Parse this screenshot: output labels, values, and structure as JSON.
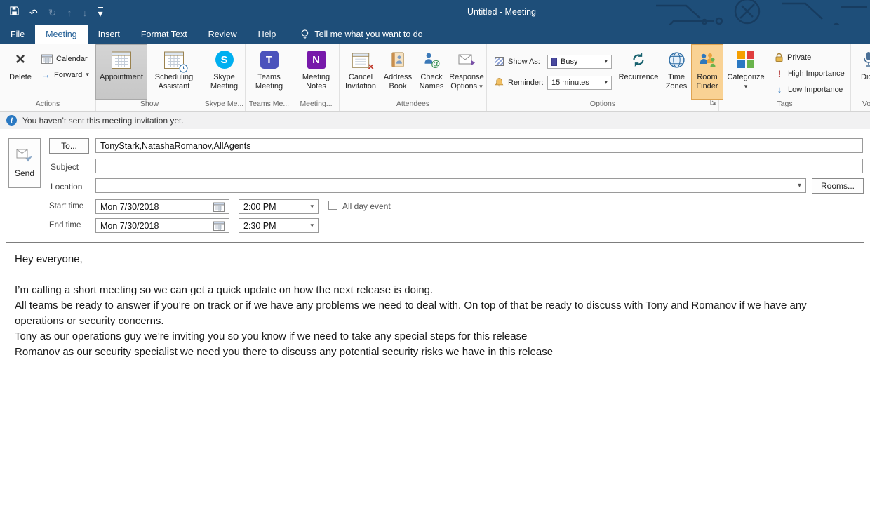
{
  "titlebar": {
    "title": "Untitled  -  Meeting"
  },
  "tabs": {
    "file": "File",
    "meeting": "Meeting",
    "insert": "Insert",
    "format_text": "Format Text",
    "review": "Review",
    "help": "Help",
    "tell_me": "Tell me what you want to do"
  },
  "ribbon": {
    "actions": {
      "delete": "Delete",
      "calendar": "Calendar",
      "forward": "Forward",
      "group_label": "Actions"
    },
    "show": {
      "appointment": "Appointment",
      "scheduling_assistant": "Scheduling Assistant",
      "group_label": "Show"
    },
    "skype": {
      "skype_meeting": "Skype Meeting",
      "group_label": "Skype Me..."
    },
    "teams": {
      "teams_meeting": "Teams Meeting",
      "group_label": "Teams Me..."
    },
    "meeting_notes_group": {
      "meeting_notes": "Meeting Notes",
      "group_label": "Meeting..."
    },
    "attendees": {
      "cancel_invitation": "Cancel Invitation",
      "address_book": "Address Book",
      "check_names": "Check Names",
      "response_options": "Response Options",
      "group_label": "Attendees"
    },
    "options": {
      "show_as_label": "Show As:",
      "show_as_value": "Busy",
      "reminder_label": "Reminder:",
      "reminder_value": "15 minutes",
      "recurrence": "Recurrence",
      "time_zones": "Time Zones",
      "room_finder": "Room Finder",
      "group_label": "Options"
    },
    "tags": {
      "categorize": "Categorize",
      "private": "Private",
      "high_importance": "High Importance",
      "low_importance": "Low Importance",
      "group_label": "Tags"
    },
    "voice": {
      "dictate": "Dictate",
      "group_label": "Voice"
    }
  },
  "infobar": {
    "message": "You haven’t sent this meeting invitation yet."
  },
  "form": {
    "send_label": "Send",
    "to_button": "To...",
    "to_value": "TonyStark,NatashaRomanov,AllAgents",
    "subject_label": "Subject",
    "location_label": "Location",
    "rooms_button": "Rooms...",
    "start_time_label": "Start time",
    "end_time_label": "End time",
    "start_date": "Mon 7/30/2018",
    "start_time": "2:00 PM",
    "end_date": "Mon 7/30/2018",
    "end_time": "2:30 PM",
    "all_day_label": "All day event"
  },
  "body": {
    "paragraphs": [
      "Hey everyone,",
      "",
      "I’m calling a short meeting so we can get a quick update on how the next release is doing.",
      "All teams be ready to answer if you’re on track or if we have any problems we need to deal with. On top of that be ready to discuss with Tony and Romanov if we have any operations or security concerns.",
      "Tony as our operations guy we’re inviting you so you know if we need to take any special steps for this release",
      "Romanov as our security specialist we need you there to discuss any potential security risks we have in this release"
    ]
  },
  "icons": {
    "delete": "×",
    "forward": "→",
    "caret": "▾",
    "undo": "↶",
    "refresh": "↻",
    "up": "↑",
    "down": "↓",
    "info": "i",
    "skype": "S",
    "teams": "T",
    "onenote": "N",
    "cancel_x": "×",
    "high_importance": "!",
    "low_importance": "↓"
  },
  "colors": {
    "titlebar": "#1e4e79",
    "accent": "#1f5c94",
    "busy": "#4a4a9f"
  }
}
